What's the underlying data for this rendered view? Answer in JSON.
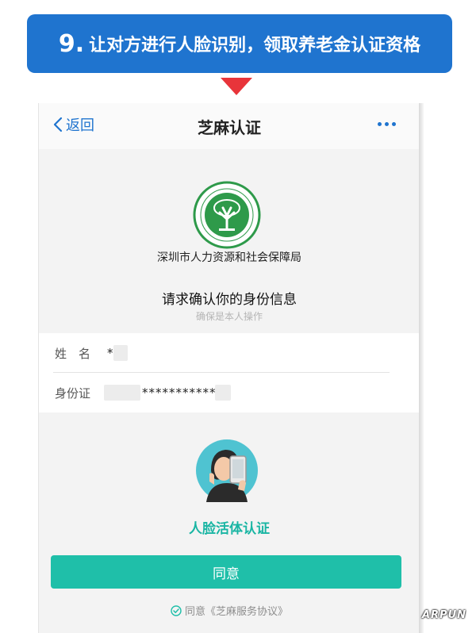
{
  "banner": {
    "step": "9.",
    "text": "让对方进行人脸识别，领取养老金认证资格"
  },
  "navbar": {
    "back_label": "返回",
    "title": "芝麻认证"
  },
  "org": {
    "name": "深圳市人力资源和社会保障局"
  },
  "confirm": {
    "title": "请求确认你的身份信息",
    "subtitle": "确保是本人操作"
  },
  "identity": {
    "name_label": "姓　名",
    "name_value": "*",
    "id_label": "身份证",
    "id_value": "***********"
  },
  "face": {
    "title": "人脸活体认证"
  },
  "actions": {
    "agree_label": "同意",
    "agreement_text": "同意《芝麻服务协议》"
  },
  "watermark": "ARPUN",
  "colors": {
    "banner": "#1f74cf",
    "arrow": "#e8343a",
    "accent": "#1fbfa9",
    "link": "#1f74cf"
  }
}
